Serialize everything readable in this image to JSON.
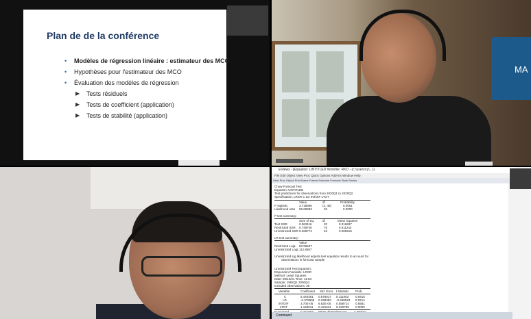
{
  "slide": {
    "title": "Plan de de la conférence",
    "bullets": [
      "Modèles de régression linéaire : estimateur des MCO",
      "Hypothèses pour l'estimateur des MCO",
      "Évaluation des modèles de régression"
    ],
    "sub_bullets": [
      "Tests résiduels",
      "Tests de coefficient (application)",
      "Tests de stabilité (application)"
    ]
  },
  "cam1": {
    "banner_text": "MA"
  },
  "eviews": {
    "title": "EViews - [Equation: UNTITLED   Workfile: RKD - (c:\\users\\ry\\...)]",
    "menu": "File  Edit  Object  View  Proc  Quick  Options  Add-ins  Window  Help",
    "toolbar": "View  Proc  Object  Print  Name  Freeze  Estimate  Forecast  Stats  Resids",
    "header_lines": [
      "Chow Forecast Test",
      "Equation: UNTITLED",
      "Test predictions for observations from 2020Q1 to 2020Q2",
      "Specification: LRSR C LD INTDIF LTOT"
    ],
    "f_table": {
      "headers": [
        "",
        "Value",
        "df",
        "Probability"
      ],
      "rows": [
        [
          "F-statistic",
          "3.718966",
          "(2, 48)",
          "0.0061"
        ],
        [
          "Likelihood ratio",
          "59.69993",
          "20",
          "0.0000"
        ]
      ]
    },
    "f_summary_title": "F-test summary:",
    "f_summary": {
      "headers": [
        "",
        "Sum of Sq.",
        "df",
        "Mean Squares"
      ],
      "rows": [
        [
          "Test SSR",
          "0.063116",
          "20",
          "0.016697"
        ],
        [
          "Restricted SSR",
          "0.748740",
          "76",
          "0.011242"
        ],
        [
          "Unrestricted SSR",
          "0.268774",
          "46",
          "0.005218"
        ]
      ]
    },
    "lr_title": "LR test summary:",
    "lr_rows": [
      [
        "",
        "Value"
      ],
      [
        "Restricted LogL",
        "82.96637"
      ],
      [
        "Unrestricted LogL",
        "112.8597"
      ]
    ],
    "note_lines": [
      "Unrestricted log likelihood adjusts test equation results to account for",
      "observations in forecast sample"
    ],
    "eq_lines": [
      "Unrestricted Test Equation:",
      "Dependent Variable: LRSR",
      "Method: Least Squares",
      "Date: 06/10/21   Time: 11:53",
      "Sample: 1992Q1 2000Q4",
      "Included observations: 36"
    ],
    "coef_table": {
      "headers": [
        "Variable",
        "Coefficient",
        "Std. Error",
        "t-Statistic",
        "Prob."
      ],
      "rows": [
        [
          "C",
          "5.440361",
          "0.578017",
          "0.111053",
          "0.9416"
        ],
        [
          "LD",
          "-0.378998",
          "0.238392",
          "-0.298523",
          "0.0214"
        ],
        [
          "INTDIF",
          "3.70E-05",
          "6.62E-05",
          "0.558714",
          "0.5581"
        ],
        [
          "LTOT",
          "1.128011",
          "0.121161",
          "9.320786",
          "0.0000"
        ]
      ]
    },
    "stat_rows": [
      [
        "R-squared",
        "0.771003",
        "Mean dependent var",
        "4.382011"
      ],
      [
        "Adjusted R-squared",
        "0.699001",
        "S.D. dependent var",
        "0.104889"
      ]
    ],
    "status": "Command"
  }
}
